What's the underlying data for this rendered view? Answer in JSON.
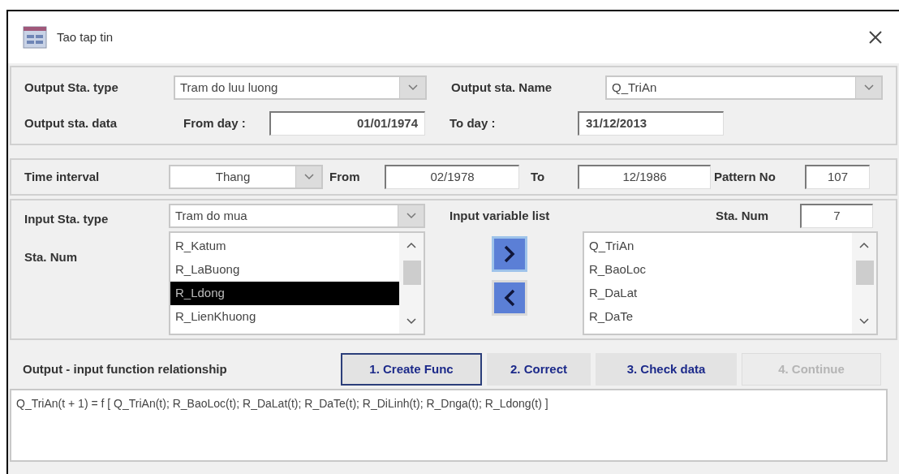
{
  "window": {
    "title": "Tao tap tin"
  },
  "output": {
    "type_label": "Output Sta. type",
    "type_value": "Tram do luu luong",
    "name_label": "Output sta. Name",
    "name_value": "Q_TriAn",
    "data_label": "Output sta. data",
    "from_label": "From day :",
    "from_value": "01/01/1974",
    "to_label": "To day :",
    "to_value": "31/12/2013"
  },
  "time": {
    "label": "Time interval",
    "interval": "Thang",
    "from_label": "From",
    "from_value": "02/1978",
    "to_label": "To",
    "to_value": "12/1986",
    "pattern_label": "Pattern No",
    "pattern_value": "107"
  },
  "input": {
    "type_label": "Input Sta. type",
    "type_value": "Tram do mua",
    "num_label": "Sta. Num",
    "var_label": "Input variable list",
    "count_label": "Sta. Num",
    "count_value": "7",
    "stations": [
      {
        "name": "R_Katum",
        "selected": false
      },
      {
        "name": "R_LaBuong",
        "selected": false
      },
      {
        "name": "R_Ldong",
        "selected": true
      },
      {
        "name": "R_LienKhuong",
        "selected": false
      }
    ],
    "variables": [
      {
        "name": "Q_TriAn",
        "selected": false
      },
      {
        "name": "R_BaoLoc",
        "selected": false
      },
      {
        "name": "R_DaLat",
        "selected": false
      },
      {
        "name": "R_DaTe",
        "selected": false
      }
    ]
  },
  "relation": {
    "label": "Output - input function relationship",
    "buttons": [
      {
        "label": "1. Create Func",
        "focused": true,
        "disabled": false
      },
      {
        "label": "2. Correct",
        "focused": false,
        "disabled": false
      },
      {
        "label": "3. Check data",
        "focused": false,
        "disabled": false
      },
      {
        "label": "4. Continue",
        "focused": false,
        "disabled": true
      }
    ],
    "formula": "Q_TriAn(t + 1) = f [ Q_TriAn(t); R_BaoLoc(t); R_DaLat(t); R_DaTe(t); R_DiLinh(t); R_Dnga(t); R_Ldong(t) ]"
  }
}
